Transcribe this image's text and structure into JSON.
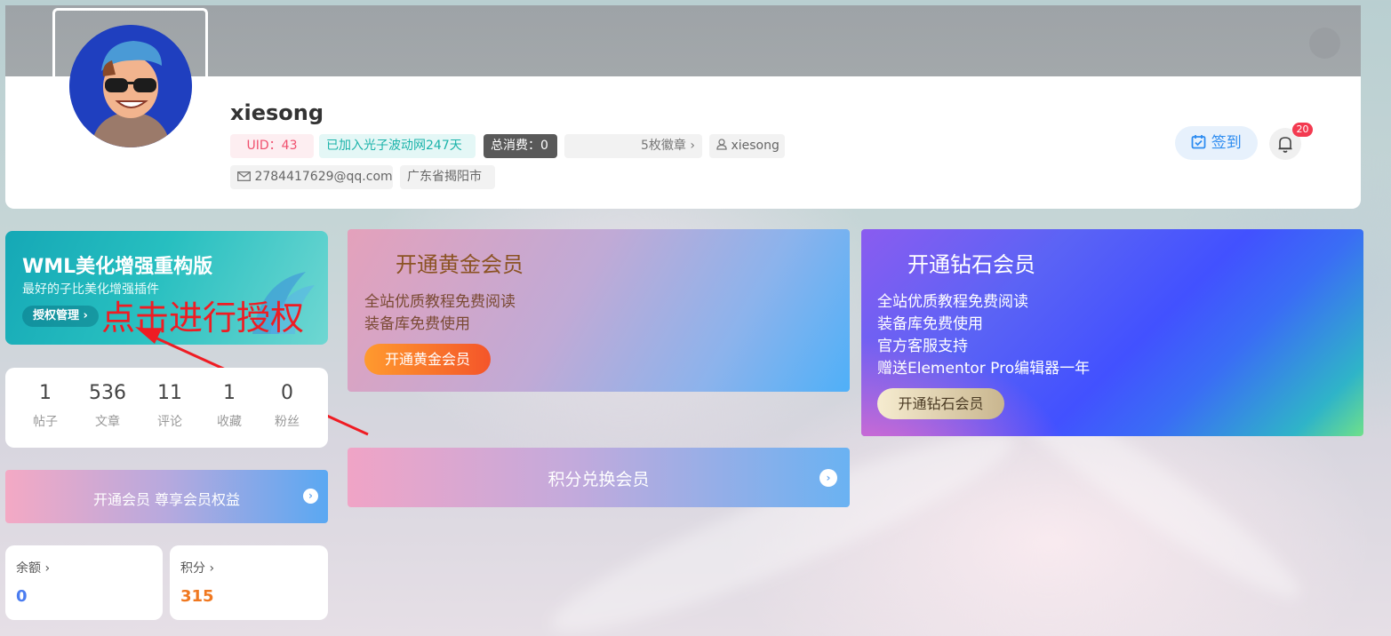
{
  "colors": {
    "accent": "#2d8cf0",
    "badge": "#f33a50",
    "annotation": "#ef1c23",
    "balance": "#4a7cf0",
    "points": "#f07820"
  },
  "profile": {
    "username": "xiesong",
    "uid": "UID：43",
    "joined": "已加入光子波动网247天",
    "total_spend": "总消费：0",
    "badges": "5枚徽章",
    "login_name": "xiesong",
    "email": "2784417629@qq.com",
    "location": "广东省揭阳市",
    "signin_label": "签到",
    "notif_count": "20"
  },
  "promo": {
    "title": "WML美化增强重构版",
    "subtitle": "最好的子比美化增强插件",
    "button": "授权管理",
    "annotation": "点击进行授权"
  },
  "stats": [
    {
      "value": "1",
      "label": "帖子"
    },
    {
      "value": "536",
      "label": "文章"
    },
    {
      "value": "11",
      "label": "评论"
    },
    {
      "value": "1",
      "label": "收藏"
    },
    {
      "value": "0",
      "label": "粉丝"
    }
  ],
  "vip_bar": {
    "text": "开通会员 尊享会员权益"
  },
  "balance": {
    "label": "余额",
    "value": "0"
  },
  "points": {
    "label": "积分",
    "value": "315"
  },
  "gold": {
    "title": "开通黄金会员",
    "lines": [
      "全站优质教程免费阅读",
      "装备库免费使用"
    ],
    "button": "开通黄金会员"
  },
  "points_exchange": {
    "text": "积分兑换会员"
  },
  "diamond": {
    "title": "开通钻石会员",
    "lines": [
      "全站优质教程免费阅读",
      "装备库免费使用",
      "官方客服支持",
      "赠送Elementor Pro编辑器一年"
    ],
    "button": "开通钻石会员"
  }
}
